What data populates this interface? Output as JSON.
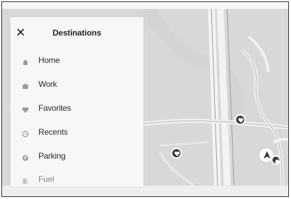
{
  "panel": {
    "title": "Destinations",
    "close_icon": "close-icon",
    "items": [
      {
        "label": "Home",
        "icon": "home-icon"
      },
      {
        "label": "Work",
        "icon": "work-icon"
      },
      {
        "label": "Favorites",
        "icon": "heart-icon"
      },
      {
        "label": "Recents",
        "icon": "clock-icon"
      },
      {
        "label": "Parking",
        "icon": "parking-icon"
      },
      {
        "label": "Fuel",
        "icon": "fuel-icon"
      }
    ]
  },
  "map": {
    "pins": [
      {
        "icon": "heart-icon"
      },
      {
        "icon": "heart-icon"
      }
    ],
    "nav_icon": "navigation-arrow-icon",
    "poi_icon": "car-icon"
  }
}
